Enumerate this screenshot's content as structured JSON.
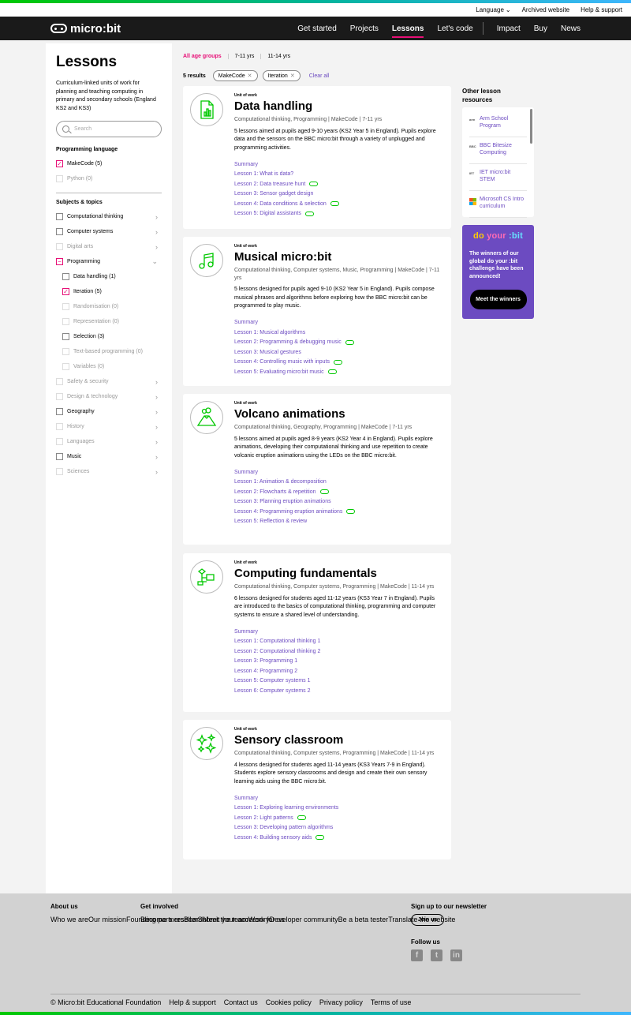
{
  "utility": {
    "language": "Language",
    "archived": "Archived website",
    "help": "Help & support"
  },
  "nav": {
    "brand": "micro:bit",
    "links": [
      "Get started",
      "Projects",
      "Lessons",
      "Let's code",
      "Impact",
      "Buy",
      "News"
    ]
  },
  "sidebar": {
    "title": "Lessons",
    "intro": "Curriculum-linked units of work for planning and teaching computing in primary and secondary schools (England KS2 and KS3)",
    "search_placeholder": "Search",
    "prog_lang_title": "Programming language",
    "prog_lang": [
      {
        "label": "MakeCode (5)",
        "checked": true
      },
      {
        "label": "Python (0)",
        "disabled": true
      }
    ],
    "subjects_title": "Subjects & topics",
    "subjects": [
      {
        "label": "Computational thinking"
      },
      {
        "label": "Computer systems"
      },
      {
        "label": "Digital arts",
        "disabled": true
      },
      {
        "label": "Programming",
        "expanded": true
      },
      {
        "label": "Data handling (1)",
        "sub": true
      },
      {
        "label": "Iteration (5)",
        "sub": true,
        "checked": true
      },
      {
        "label": "Randomisation (0)",
        "sub": true,
        "disabled": true
      },
      {
        "label": "Representation (0)",
        "sub": true,
        "disabled": true
      },
      {
        "label": "Selection (3)",
        "sub": true
      },
      {
        "label": "Text-based programming (0)",
        "sub": true,
        "disabled": true
      },
      {
        "label": "Variables (0)",
        "sub": true,
        "disabled": true
      },
      {
        "label": "Safety & security",
        "disabled": true
      },
      {
        "label": "Design & technology",
        "disabled": true
      },
      {
        "label": "Geography"
      },
      {
        "label": "History",
        "disabled": true
      },
      {
        "label": "Languages",
        "disabled": true
      },
      {
        "label": "Music"
      },
      {
        "label": "Sciences",
        "disabled": true
      }
    ]
  },
  "filters": {
    "age_groups": [
      "All age groups",
      "7-11 yrs",
      "11-14 yrs"
    ],
    "results": "5 results",
    "chips": [
      "MakeCode",
      "Iteration"
    ],
    "clear": "Clear all"
  },
  "cards": [
    {
      "kicker": "Unit of work",
      "title": "Data handling",
      "tags": "Computational thinking, Programming | MakeCode | 7-11 yrs",
      "desc": "5 lessons aimed at pupils aged 9-10 years (KS2 Year 5 in England). Pupils explore data and the sensors on the BBC micro:bit through a variety of unplugged and programming activities.",
      "links": [
        {
          "t": "Summary"
        },
        {
          "t": "Lesson 1: What is data?"
        },
        {
          "t": "Lesson 2: Data treasure hunt",
          "p": true
        },
        {
          "t": "Lesson 3: Sensor gadget design"
        },
        {
          "t": "Lesson 4: Data conditions & selection",
          "p": true
        },
        {
          "t": "Lesson 5: Digital assistants",
          "p": true
        }
      ]
    },
    {
      "kicker": "Unit of work",
      "title": "Musical micro:bit",
      "tags": "Computational thinking, Computer systems, Music, Programming | MakeCode | 7-11 yrs",
      "desc": "5 lessons designed for pupils aged 9-10 (KS2 Year 5 in England). Pupils compose musical phrases and algorithms before exploring how the BBC micro:bit can be programmed to play music.",
      "links": [
        {
          "t": "Summary"
        },
        {
          "t": "Lesson 1: Musical algorithms"
        },
        {
          "t": "Lesson 2: Programming & debugging music",
          "p": true
        },
        {
          "t": "Lesson 3: Musical gestures"
        },
        {
          "t": "Lesson 4: Controlling music with inputs",
          "p": true
        },
        {
          "t": "Lesson 5: Evaluating micro:bit music",
          "p": true
        }
      ]
    },
    {
      "kicker": "Unit of work",
      "title": "Volcano animations",
      "tags": "Computational thinking, Geography, Programming | MakeCode | 7-11 yrs",
      "desc": "5 lessons aimed at pupils aged 8-9 years (KS2 Year 4 in England). Pupils explore animations, developing their computational thinking and use repetition to create volcanic eruption animations using the LEDs on the BBC micro:bit.",
      "links": [
        {
          "t": "Summary"
        },
        {
          "t": "Lesson 1: Animation & decomposition"
        },
        {
          "t": "Lesson 2: Flowcharts & repetition",
          "p": true
        },
        {
          "t": "Lesson 3: Planning eruption animations"
        },
        {
          "t": "Lesson 4: Programming eruption animations",
          "p": true
        },
        {
          "t": "Lesson 5: Reflection & review"
        }
      ]
    },
    {
      "kicker": "Unit of work",
      "title": "Computing fundamentals",
      "tags": "Computational thinking, Computer systems, Programming | MakeCode | 11-14 yrs",
      "desc": "6 lessons designed for students aged 11-12 years (KS3 Year 7 in England). Pupils are introduced to the basics of computational thinking, programming and computer systems to ensure a shared level of understanding.",
      "links": [
        {
          "t": "Summary"
        },
        {
          "t": "Lesson 1: Computational thinking 1"
        },
        {
          "t": "Lesson 2: Computational thinking 2"
        },
        {
          "t": "Lesson 3: Programming 1"
        },
        {
          "t": "Lesson 4: Programming 2"
        },
        {
          "t": "Lesson 5: Computer systems 1"
        },
        {
          "t": "Lesson 6: Computer systems 2"
        }
      ]
    },
    {
      "kicker": "Unit of work",
      "title": "Sensory classroom",
      "tags": "Computational thinking, Computer systems, Programming | MakeCode | 11-14 yrs",
      "desc": "4 lessons designed for students aged 11-14 years (KS3 Years 7-9 in England). Students explore sensory classrooms and design and create their own sensory learning aids using the BBC micro:bit.",
      "links": [
        {
          "t": "Summary"
        },
        {
          "t": "Lesson 1: Exploring learning environments"
        },
        {
          "t": "Lesson 2: Light patterns",
          "p": true
        },
        {
          "t": "Lesson 3: Developing pattern algorithms"
        },
        {
          "t": "Lesson 4: Building sensory aids",
          "p": true
        }
      ]
    }
  ],
  "other": {
    "title": "Other lesson resources",
    "items": [
      {
        "logo": "arm",
        "label": "Arm School Program"
      },
      {
        "logo": "BBC",
        "label": "BBC Bitesize Computing"
      },
      {
        "logo": "IET",
        "label": "IET micro:bit STEM"
      },
      {
        "logo": "MS",
        "label": "Microsoft CS Intro curriculum"
      }
    ]
  },
  "promo": {
    "logo": [
      "do ",
      "your ",
      ":bit"
    ],
    "text": "The winners of our global do your :bit challenge have been announced!",
    "button": "Meet the winners"
  },
  "footer": {
    "about_title": "About us",
    "about": [
      "Who we are",
      "Our mission",
      "Founding partners",
      "Board",
      "Meet the team",
      "Work for us"
    ],
    "involved_title": "Get involved",
    "involved": [
      "Become a reseller",
      "Submit your accessory",
      "Developer community",
      "Be a beta tester",
      "Translate the website"
    ],
    "newsletter_title": "Sign up to our newsletter",
    "join": "Join us",
    "follow_title": "Follow us",
    "social": [
      "f",
      "t",
      "in"
    ],
    "bottom": [
      "© Micro:bit Educational Foundation",
      "Help & support",
      "Contact us",
      "Cookies policy",
      "Privacy policy",
      "Terms of use"
    ]
  },
  "colors": {
    "accent": "#e70f77",
    "link": "#6c4bc1",
    "green": "#00c800",
    "promo": "#6c4bc1"
  }
}
